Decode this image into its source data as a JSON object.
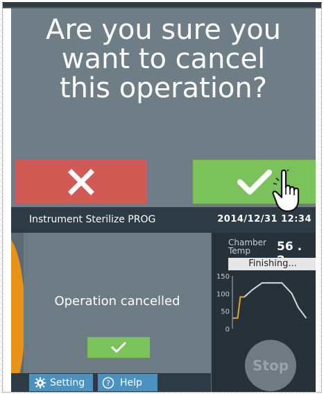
{
  "dialog": {
    "prompt_lines": [
      "Are you sure you",
      "want to cancel",
      "this operation?"
    ],
    "cancel_icon": "x-icon",
    "confirm_icon": "checkmark-icon",
    "cancel_color": "#d15a55",
    "confirm_color": "#7cc25c"
  },
  "status_screen": {
    "program_title": "Instrument Sterilize PROG",
    "datetime": "2014/12/31 12:34",
    "message": "Operation cancelled",
    "ok_icon": "checkmark-icon",
    "chamber_label_line1": "Chamber",
    "chamber_label_line2": "Temp",
    "chamber_temp": "56 . 2",
    "temp_unit": "℃",
    "phase": "Finishing...",
    "stop_label": "Stop",
    "footer": {
      "setting_label": "Setting",
      "setting_icon": "gear-icon",
      "help_label": "Help",
      "help_icon": "question-circle-icon"
    }
  },
  "chart_data": {
    "type": "line",
    "ylim": [
      0,
      150
    ],
    "y_ticks": [
      "150",
      "100",
      "50",
      "0"
    ],
    "series": [
      {
        "color": "#f0a020",
        "x": [
          0,
          8,
          12,
          18
        ],
        "y": [
          30,
          30,
          90,
          90
        ]
      },
      {
        "color": "#d9d9d9",
        "x": [
          18,
          30,
          45,
          60,
          75,
          90,
          100,
          112
        ],
        "y": [
          90,
          110,
          130,
          130,
          130,
          100,
          60,
          30
        ]
      }
    ],
    "xlim": [
      0,
      120
    ]
  },
  "colors": {
    "accent_orange": "#e99218",
    "button_blue": "#4c92c1",
    "screen_gray": "#6f7d87"
  }
}
